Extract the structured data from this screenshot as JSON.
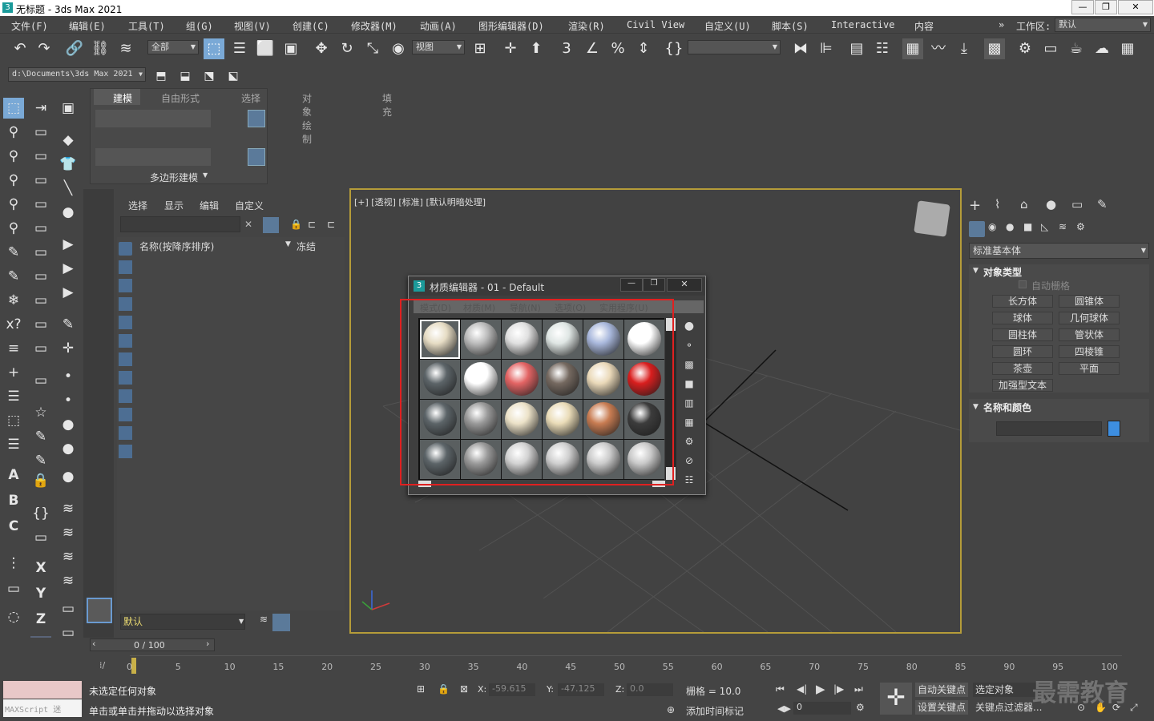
{
  "app": {
    "title": "无标题 - 3ds Max 2021",
    "icon": "3"
  },
  "menu": [
    "文件(F)",
    "编辑(E)",
    "工具(T)",
    "组(G)",
    "视图(V)",
    "创建(C)",
    "修改器(M)",
    "动画(A)",
    "图形编辑器(D)",
    "渲染(R)",
    "Civil View",
    "自定义(U)",
    "脚本(S)",
    "Interactive",
    "内容"
  ],
  "workspace": {
    "label": "工作区:",
    "value": "默认",
    "chevron": "»"
  },
  "toolbar": {
    "selection_filter": "全部",
    "ref_coord": "视图"
  },
  "project_path": "d:\\Documents\\3ds Max 2021",
  "ribbon": {
    "tabs": [
      "建模",
      "自由形式",
      "选择",
      "对象绘制",
      "填充"
    ],
    "panel_label": "多边形建模"
  },
  "scene_explorer": {
    "tabs": [
      "选择",
      "显示",
      "编辑",
      "自定义"
    ],
    "col_name": "名称(按降序排序)",
    "col_freeze": "冻结",
    "layer": "默认"
  },
  "viewport": {
    "label": "[+] [透视] [标准] [默认明暗处理]"
  },
  "material_editor": {
    "title": "材质编辑器 - 01 - Default",
    "icon": "3",
    "menus": [
      "模式(D)",
      "材质(M)",
      "导航(N)",
      "选项(O)",
      "实用程序(U)"
    ],
    "slots": [
      [
        "#e6dcc4",
        "#bcbcbc",
        "#e0e0e0",
        "#dfe6e4",
        "#a9b8dc",
        "#ffffff"
      ],
      [
        "#5c6468",
        "#ffffff",
        "#e36464",
        "#756960",
        "#ead9b9",
        "#d91e1e"
      ],
      [
        "#5c6468",
        "#9a9a9a",
        "#ece2c8",
        "#eadcb8",
        "#c87c52",
        "#3c3c3c"
      ],
      [
        "#5c6468",
        "#9a9a9a",
        "#d2d2d2",
        "#cfcfcf",
        "#cbcbcb",
        "#c9c9c9"
      ]
    ]
  },
  "command_panel": {
    "category": "标准基本体",
    "rollout_object_type": "对象类型",
    "autogrid": "自动栅格",
    "buttons": [
      "长方体",
      "圆锥体",
      "球体",
      "几何球体",
      "圆柱体",
      "管状体",
      "圆环",
      "四棱锥",
      "茶壶",
      "平面",
      "加强型文本"
    ],
    "rollout_name_color": "名称和颜色",
    "color": "#3d8ee0"
  },
  "timeline": {
    "frame": "0 / 100",
    "ticks": [
      "0",
      "5",
      "10",
      "15",
      "20",
      "25",
      "30",
      "35",
      "40",
      "45",
      "50",
      "55",
      "60",
      "65",
      "70",
      "75",
      "80",
      "85",
      "90",
      "95",
      "100"
    ]
  },
  "status": {
    "line1": "未选定任何对象",
    "line2": "单击或单击并拖动以选择对象",
    "maxscript": "MAXScript 迷",
    "x_label": "X:",
    "x": "-59.615",
    "y_label": "Y:",
    "y": "-47.125",
    "z_label": "Z:",
    "z": "0.0",
    "grid": "栅格 = 10.0",
    "add_time_tag": "添加时间标记",
    "auto_key": "自动关键点",
    "selected": "选定对象",
    "set_key": "设置关键点",
    "key_filter": "关键点过滤器...",
    "frame_field": "0"
  },
  "watermark": "最需教育"
}
